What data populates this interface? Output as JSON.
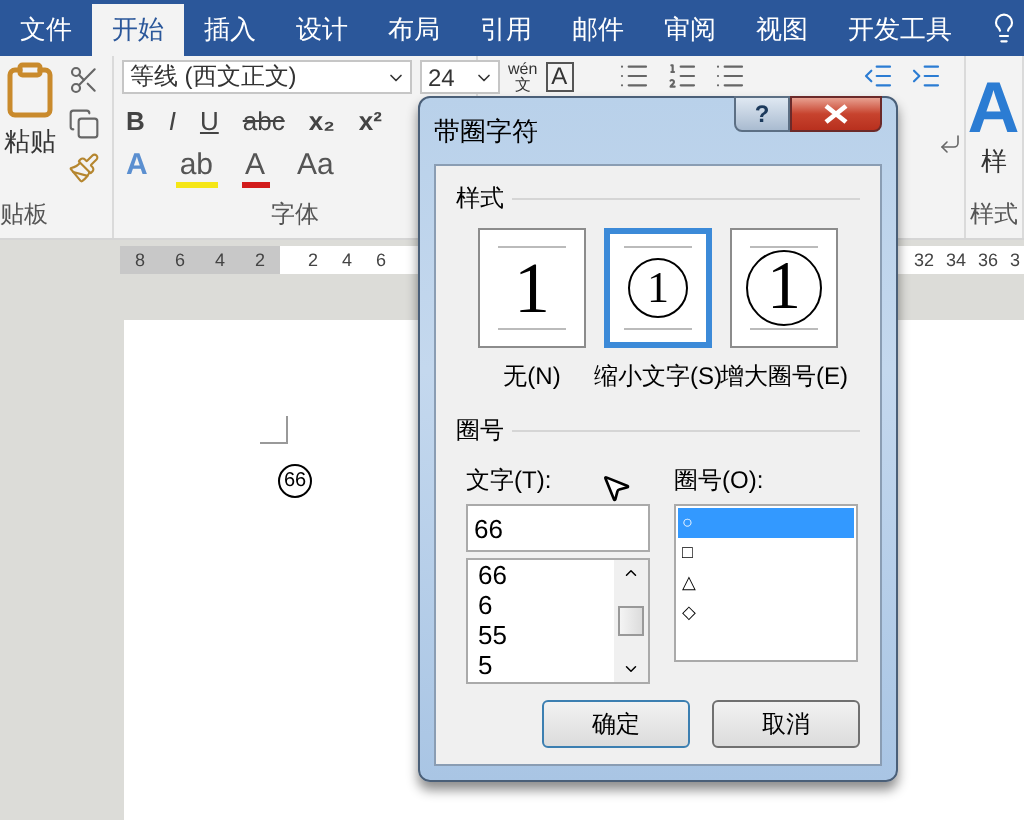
{
  "tabs": [
    {
      "label": "文件",
      "selected": false
    },
    {
      "label": "开始",
      "selected": true
    },
    {
      "label": "插入",
      "selected": false
    },
    {
      "label": "设计",
      "selected": false
    },
    {
      "label": "布局",
      "selected": false
    },
    {
      "label": "引用",
      "selected": false
    },
    {
      "label": "邮件",
      "selected": false
    },
    {
      "label": "审阅",
      "selected": false
    },
    {
      "label": "视图",
      "selected": false
    },
    {
      "label": "开发工具",
      "selected": false
    }
  ],
  "ribbon": {
    "clipboard": {
      "paste_label": "粘贴",
      "group_label": "贴板"
    },
    "font": {
      "font_name": "等线 (西文正文)",
      "font_size": "24",
      "phonetic_top": "wén",
      "phonetic_bottom": "文",
      "border_char": "A",
      "format_buttons": [
        {
          "kind": "bold",
          "label": "B"
        },
        {
          "kind": "italic",
          "label": "I"
        },
        {
          "kind": "underline",
          "label": "U"
        },
        {
          "kind": "strike",
          "label": "abc"
        },
        {
          "kind": "sub",
          "label": "x₂"
        },
        {
          "kind": "sup",
          "label": "x²"
        }
      ],
      "effect_buttons": [
        {
          "kind": "effect",
          "label": "A"
        },
        {
          "kind": "highlight",
          "label": "ab"
        },
        {
          "kind": "color",
          "label": "A"
        },
        {
          "kind": "case",
          "label": "Aa"
        }
      ],
      "group_label": "字体"
    },
    "styles": {
      "sample": "A",
      "label": "样",
      "group_label": "样式"
    }
  },
  "ruler": {
    "left_ticks": [
      "8",
      "6",
      "4",
      "2"
    ],
    "mid_ticks": [
      "2",
      "4",
      "6"
    ],
    "right_ticks": [
      "32",
      "34",
      "36",
      "3"
    ]
  },
  "document": {
    "enclosed_text": "66"
  },
  "dialog": {
    "title": "带圈字符",
    "help": "?",
    "style_section": "样式",
    "styles": [
      {
        "kind": "none",
        "label": "无(N)",
        "sample": "1",
        "selected": false
      },
      {
        "kind": "shrink",
        "label": "缩小文字(S)",
        "sample": "1",
        "selected": true
      },
      {
        "kind": "enlarge",
        "label": "增大圈号(E)",
        "sample": "1",
        "selected": false
      }
    ],
    "enclose_section": "圈号",
    "text_label": "文字(T):",
    "text_value": "66",
    "text_options": [
      "66",
      "6",
      "55",
      "5"
    ],
    "enclosure_label": "圈号(O):",
    "enclosures": [
      {
        "symbol": "○",
        "selected": true
      },
      {
        "symbol": "□",
        "selected": false
      },
      {
        "symbol": "△",
        "selected": false
      },
      {
        "symbol": "◇",
        "selected": false
      }
    ],
    "ok": "确定",
    "cancel": "取消"
  }
}
